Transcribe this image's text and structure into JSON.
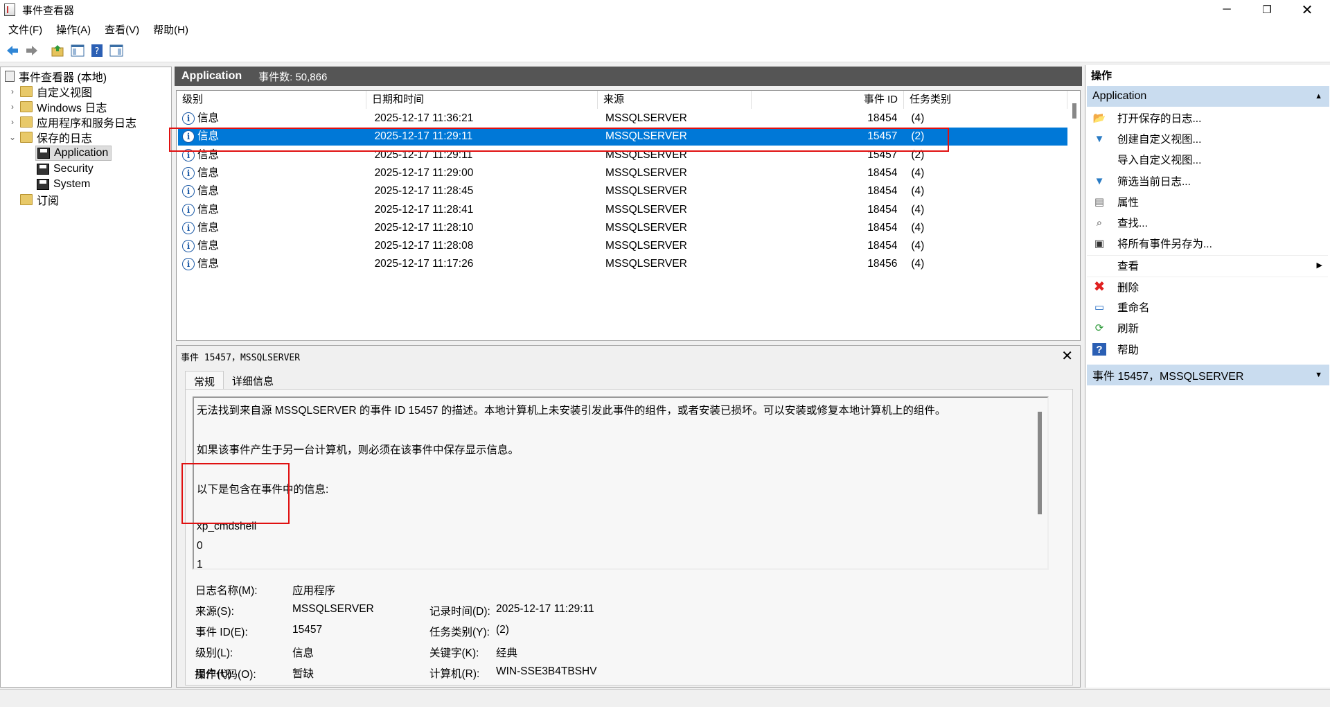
{
  "window": {
    "title": "事件查看器",
    "controls": [
      "minimize-icon",
      "restore-icon",
      "close-icon"
    ]
  },
  "menu": [
    "文件(F)",
    "操作(A)",
    "查看(V)",
    "帮助(H)"
  ],
  "toolbar": [
    "back-icon",
    "forward-icon",
    "folder-up-icon",
    "show-hide-tree-icon",
    "help-icon",
    "show-hide-action-icon"
  ],
  "tree": {
    "root": "事件查看器 (本地)",
    "items": [
      {
        "label": "自定义视图"
      },
      {
        "label": "Windows 日志"
      },
      {
        "label": "应用程序和服务日志"
      },
      {
        "label": "保存的日志"
      },
      {
        "label": "Application"
      },
      {
        "label": "Security"
      },
      {
        "label": "System"
      },
      {
        "label": "订阅"
      }
    ]
  },
  "log": {
    "name": "Application",
    "count": "事件数: 50,866"
  },
  "columns": [
    "级别",
    "日期和时间",
    "来源",
    "事件 ID",
    "任务类别"
  ],
  "rows": [
    {
      "level": "信息",
      "datetime": "2025-12-17 11:36:21",
      "source": "MSSQLSERVER",
      "id": "18454",
      "task": "(4)"
    },
    {
      "level": "信息",
      "datetime": "2025-12-17 11:29:11",
      "source": "MSSQLSERVER",
      "id": "15457",
      "task": "(2)"
    },
    {
      "level": "信息",
      "datetime": "2025-12-17 11:29:11",
      "source": "MSSQLSERVER",
      "id": "15457",
      "task": "(2)"
    },
    {
      "level": "信息",
      "datetime": "2025-12-17 11:29:00",
      "source": "MSSQLSERVER",
      "id": "18454",
      "task": "(4)"
    },
    {
      "level": "信息",
      "datetime": "2025-12-17 11:28:45",
      "source": "MSSQLSERVER",
      "id": "18454",
      "task": "(4)"
    },
    {
      "level": "信息",
      "datetime": "2025-12-17 11:28:41",
      "source": "MSSQLSERVER",
      "id": "18454",
      "task": "(4)"
    },
    {
      "level": "信息",
      "datetime": "2025-12-17 11:28:10",
      "source": "MSSQLSERVER",
      "id": "18454",
      "task": "(4)"
    },
    {
      "level": "信息",
      "datetime": "2025-12-17 11:28:08",
      "source": "MSSQLSERVER",
      "id": "18454",
      "task": "(4)"
    },
    {
      "level": "信息",
      "datetime": "2025-12-17 11:17:26",
      "source": "MSSQLSERVER",
      "id": "18456",
      "task": "(4)"
    }
  ],
  "detail": {
    "title": "事件 15457，MSSQLSERVER",
    "tabs": [
      "常规",
      "详细信息"
    ],
    "description": [
      "无法找到来自源 MSSQLSERVER 的事件 ID 15457 的描述。本地计算机上未安装引发此事件的组件，或者安装已损坏。可以安装或修复本地计算机上的组件。",
      "如果该事件产生于另一台计算机，则必须在该事件中保存显示信息。",
      "以下是包含在事件中的信息:",
      "xp_cmdshell",
      "0",
      "1"
    ],
    "fields": {
      "log_name_label": "日志名称(M):",
      "log_name": "应用程序",
      "source_label": "来源(S):",
      "source": "MSSQLSERVER",
      "logged_label": "记录时间(D):",
      "logged": "2025-12-17 11:29:11",
      "event_id_label": "事件 ID(E):",
      "event_id": "15457",
      "task_label": "任务类别(Y):",
      "task": "(2)",
      "level_label": "级别(L):",
      "level": "信息",
      "keywords_label": "关键字(K):",
      "keywords": "经典",
      "user_label": "用户(U):",
      "user": "暂缺",
      "computer_label": "计算机(R):",
      "computer": "WIN-SSE3B4TBSHV",
      "opcode_label": "操作代码(O):"
    }
  },
  "actions": {
    "header": "操作",
    "section1": "Application",
    "items1": [
      {
        "icon": "open-log-icon",
        "label": "打开保存的日志..."
      },
      {
        "icon": "filter-icon",
        "label": "创建自定义视图..."
      },
      {
        "icon": "",
        "label": "导入自定义视图..."
      },
      {
        "icon": "filter-icon",
        "label": "筛选当前日志..."
      },
      {
        "icon": "properties-icon",
        "label": "属性"
      },
      {
        "icon": "find-icon",
        "label": "查找..."
      },
      {
        "icon": "save-icon",
        "label": "将所有事件另存为..."
      },
      {
        "icon": "",
        "label": "查看"
      },
      {
        "icon": "delete-icon",
        "label": "删除"
      },
      {
        "icon": "rename-icon",
        "label": "重命名"
      },
      {
        "icon": "refresh-icon",
        "label": "刷新"
      },
      {
        "icon": "help-icon",
        "label": "帮助"
      }
    ],
    "section2": "事件 15457，MSSQLSERVER"
  },
  "colors": {
    "selection": "#0078d7",
    "header_bar": "#555555",
    "action_section": "#c9dcef",
    "highlight_box": "#e01010"
  }
}
